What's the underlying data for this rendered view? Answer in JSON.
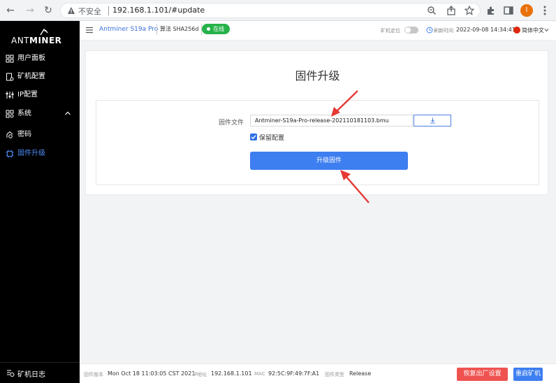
{
  "browser": {
    "insecure_label": "不安全",
    "url": "192.168.1.101/#update",
    "avatar_letter": "I"
  },
  "sidebar": {
    "logo_prefix": "ANT",
    "logo_suffix": "MINER",
    "items": [
      {
        "label": "用户面板",
        "icon": "dashboard-icon"
      },
      {
        "label": "矿机配置",
        "icon": "miner-config-icon"
      },
      {
        "label": "IP配置",
        "icon": "ip-config-icon"
      },
      {
        "label": "系统",
        "icon": "system-icon",
        "expanded": true
      },
      {
        "label": "密码",
        "icon": "password-icon"
      },
      {
        "label": "固件升级",
        "icon": "firmware-icon",
        "active": true
      }
    ],
    "footer_label": "矿机日志"
  },
  "header": {
    "model": "Antminer S19a Pro",
    "algo": "算法 SHA256d",
    "status": "在线",
    "locate_label": "矿机定位",
    "refresh_label": "刷新时间",
    "refresh_time": "2022-09-08 14:34:41",
    "language": "简体中文"
  },
  "page": {
    "title": "固件升级",
    "file_label": "固件文件",
    "file_value": "Antminer-S19a-Pro-release-202110181103.bmu",
    "keep_settings_label": "保留配置",
    "keep_settings_checked": true,
    "upgrade_button": "升级固件"
  },
  "footer": {
    "fw_version_label": "固件版本",
    "fw_version": "Mon Oct 18 11:03:05 CST 2021",
    "ip_label": "IP地址",
    "ip": "192.168.1.101",
    "mac_label": "MAC",
    "mac": "92:5C:9F:49:7F:A1",
    "fw_type_label": "固件类型",
    "fw_type": "Release",
    "reset_button": "恢复出厂设置",
    "reboot_button": "重启矿机"
  },
  "colors": {
    "accent": "#3d7ef0",
    "online": "#27b24a",
    "danger": "#ef5350",
    "annotation_arrow": "#e53935"
  }
}
